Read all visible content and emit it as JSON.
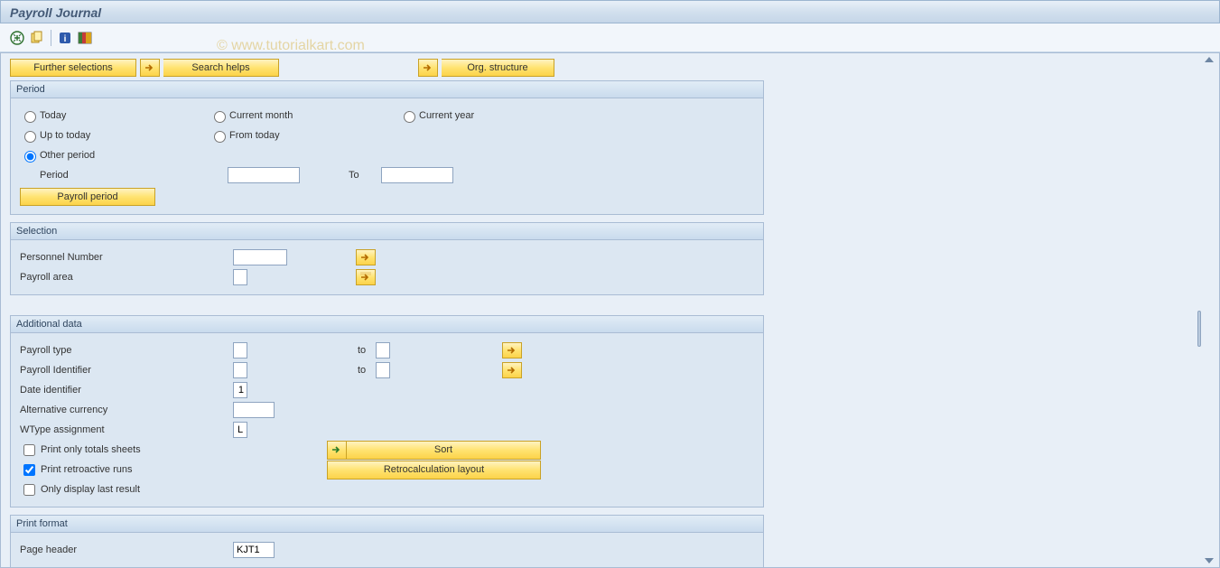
{
  "title": "Payroll Journal",
  "watermark": "© www.tutorialkart.com",
  "toolbar": {
    "execute_icon": "execute",
    "variant_icon": "variant",
    "info_icon": "info",
    "layout_icon": "layout"
  },
  "buttons": {
    "further_selections": "Further selections",
    "search_helps": "Search helps",
    "org_structure": "Org. structure",
    "payroll_period": "Payroll period",
    "sort": "Sort",
    "retro_layout": "Retrocalculation layout"
  },
  "groups": {
    "period": {
      "title": "Period",
      "options": {
        "today": "Today",
        "up_to_today": "Up to today",
        "other_period": "Other period",
        "current_month": "Current month",
        "from_today": "From today",
        "current_year": "Current year"
      },
      "selected": "other_period",
      "period_label": "Period",
      "period_from": "",
      "to_label": "To",
      "period_to": ""
    },
    "selection": {
      "title": "Selection",
      "personnel_number_label": "Personnel Number",
      "personnel_number_value": "",
      "payroll_area_label": "Payroll area",
      "payroll_area_value": ""
    },
    "additional": {
      "title": "Additional data",
      "payroll_type_label": "Payroll type",
      "payroll_type_from": "",
      "payroll_type_to": "",
      "payroll_id_label": "Payroll Identifier",
      "payroll_id_from": "",
      "payroll_id_to": "",
      "to_label": "to",
      "date_id_label": "Date identifier",
      "date_id_value": "1",
      "alt_currency_label": "Alternative currency",
      "alt_currency_value": "",
      "wtype_label": "WType assignment",
      "wtype_value": "L",
      "print_totals_label": "Print only totals sheets",
      "print_totals_checked": false,
      "print_retro_label": "Print retroactive runs",
      "print_retro_checked": true,
      "only_last_label": "Only display last result",
      "only_last_checked": false
    },
    "print_format": {
      "title": "Print format",
      "page_header_label": "Page header",
      "page_header_value": "KJT1"
    }
  }
}
